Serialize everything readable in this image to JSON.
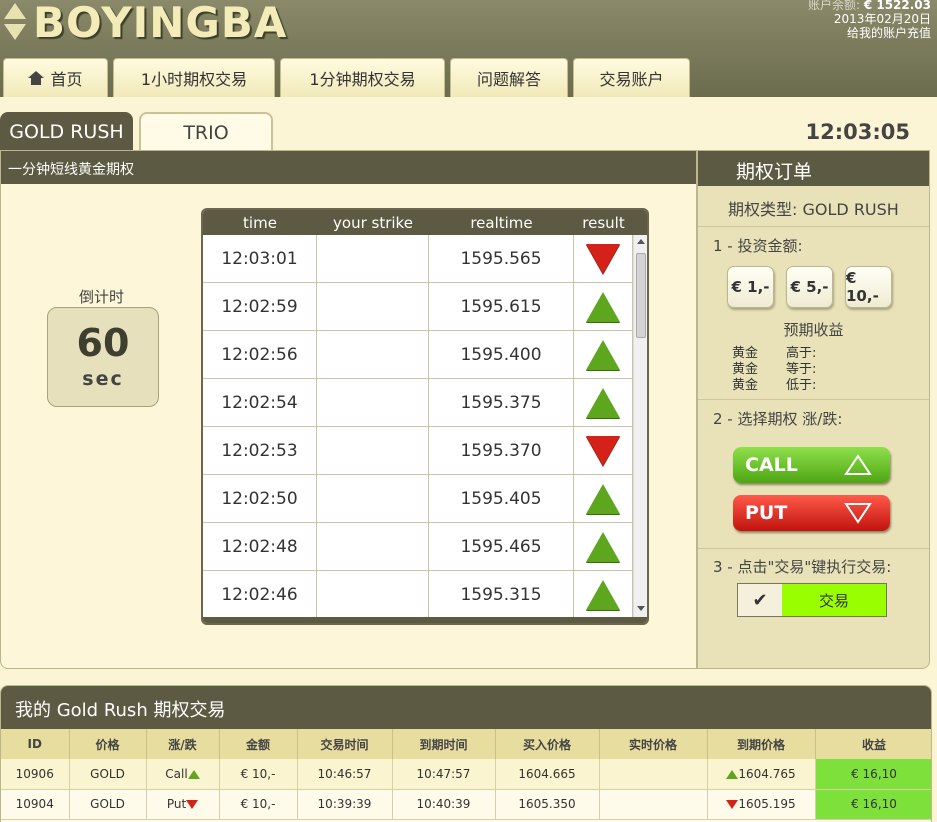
{
  "header": {
    "logo_text": "BOYINGBA",
    "balance_label": "账户余额:",
    "balance_value": "€ 1522.03",
    "date": "2013年02月20日",
    "topup_link": "给我的账户充值"
  },
  "nav": {
    "items": [
      {
        "label": "首页",
        "icon": "home-icon"
      },
      {
        "label": "1小时期权交易"
      },
      {
        "label": "1分钟期权交易"
      },
      {
        "label": "问题解答"
      },
      {
        "label": "交易账户"
      }
    ]
  },
  "game_tabs": {
    "active": "GOLD RUSH",
    "inactive": "TRIO"
  },
  "clock": "12:03:05",
  "main": {
    "title": "一分钟短线黄金期权",
    "countdown_label": "倒计时",
    "countdown_value": "60",
    "countdown_unit": "sec",
    "ticker_headers": [
      "time",
      "your strike",
      "realtime",
      "result"
    ],
    "ticker_rows": [
      {
        "time": "12:03:01",
        "strike": "",
        "realtime": "1595.565",
        "result": "down"
      },
      {
        "time": "12:02:59",
        "strike": "",
        "realtime": "1595.615",
        "result": "up"
      },
      {
        "time": "12:02:56",
        "strike": "",
        "realtime": "1595.400",
        "result": "up"
      },
      {
        "time": "12:02:54",
        "strike": "",
        "realtime": "1595.375",
        "result": "up"
      },
      {
        "time": "12:02:53",
        "strike": "",
        "realtime": "1595.370",
        "result": "down"
      },
      {
        "time": "12:02:50",
        "strike": "",
        "realtime": "1595.405",
        "result": "up"
      },
      {
        "time": "12:02:48",
        "strike": "",
        "realtime": "1595.465",
        "result": "up"
      },
      {
        "time": "12:02:46",
        "strike": "",
        "realtime": "1595.315",
        "result": "up"
      }
    ]
  },
  "order": {
    "title": "期权订单",
    "option_type_label": "期权类型:",
    "option_type_value": "GOLD RUSH",
    "step1": "1 - 投资金额:",
    "amounts": [
      "€ 1,-",
      "€ 5,-",
      "€ 10,-"
    ],
    "expected_label": "预期收益",
    "expected_rows": [
      {
        "asset": "黄金",
        "condition": "高于:"
      },
      {
        "asset": "黄金",
        "condition": "等于:"
      },
      {
        "asset": "黄金",
        "condition": "低于:"
      }
    ],
    "step2": "2 - 选择期权 涨/跌:",
    "call_label": "CALL",
    "put_label": "PUT",
    "step3": "3 - 点击\"交易\"键执行交易:",
    "trade_check": "✔",
    "trade_label": "交易"
  },
  "trades": {
    "title": "我的 Gold Rush 期权交易",
    "headers": [
      "ID",
      "价格",
      "涨/跌",
      "金额",
      "交易时间",
      "到期时间",
      "买入价格",
      "实时价格",
      "到期价格",
      "收益"
    ],
    "rows": [
      {
        "id": "10906",
        "asset": "GOLD",
        "direction": "Call",
        "dir": "up",
        "amount": "€ 10,-",
        "trade_time": "10:46:57",
        "expiry": "10:47:57",
        "buy_price": "1604.665",
        "realtime": "",
        "expiry_price": "1604.765",
        "profit": "€ 16,10"
      },
      {
        "id": "10904",
        "asset": "GOLD",
        "direction": "Put",
        "dir": "down",
        "amount": "€ 10,-",
        "trade_time": "10:39:39",
        "expiry": "10:40:39",
        "buy_price": "1605.350",
        "realtime": "",
        "expiry_price": "1605.195",
        "profit": "€ 16,10"
      }
    ]
  },
  "colors": {
    "header_bg": "#6b6b4e",
    "panel_bar": "#5c5a42",
    "page_bg": "#fbf5d6",
    "call_green": "#5ea61e",
    "put_red": "#d42218",
    "trade_green": "#99ff00",
    "profit_green": "#7ee03a"
  }
}
